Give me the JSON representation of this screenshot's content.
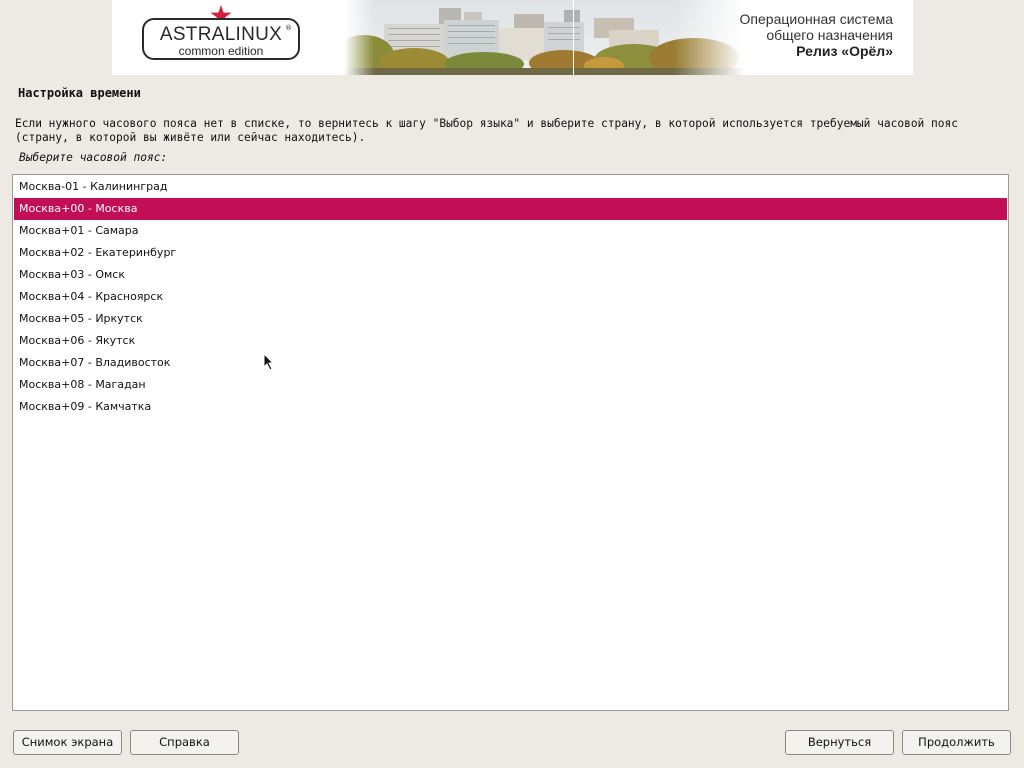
{
  "banner": {
    "logo_title": "ASTRALINUX",
    "logo_subtitle": "common edition",
    "logo_registered": "®",
    "release_line1": "Операционная система",
    "release_line2": "общего назначения",
    "release_name": "Релиз «Орёл»"
  },
  "page": {
    "title": "Настройка времени",
    "description": "Если нужного часового пояса нет в списке, то вернитесь к шагу \"Выбор языка\" и выберите страну, в которой используется требуемый часовой пояс (страну, в которой вы живёте или сейчас находитесь).",
    "prompt": "Выберите часовой пояс:"
  },
  "timezones": [
    {
      "label": "Москва-01 - Калининград",
      "selected": false
    },
    {
      "label": "Москва+00 - Москва",
      "selected": true
    },
    {
      "label": "Москва+01 - Самара",
      "selected": false
    },
    {
      "label": "Москва+02 - Екатеринбург",
      "selected": false
    },
    {
      "label": "Москва+03 - Омск",
      "selected": false
    },
    {
      "label": "Москва+04 - Красноярск",
      "selected": false
    },
    {
      "label": "Москва+05 - Иркутск",
      "selected": false
    },
    {
      "label": "Москва+06 - Якутск",
      "selected": false
    },
    {
      "label": "Москва+07 - Владивосток",
      "selected": false
    },
    {
      "label": "Москва+08 - Магадан",
      "selected": false
    },
    {
      "label": "Москва+09 - Камчатка",
      "selected": false
    }
  ],
  "buttons": {
    "screenshot": "Снимок экрана",
    "help": "Справка",
    "back": "Вернуться",
    "continue": "Продолжить"
  },
  "colors": {
    "selection": "#c20e55",
    "background": "#edeae4",
    "logo_star": "#d4213b"
  }
}
